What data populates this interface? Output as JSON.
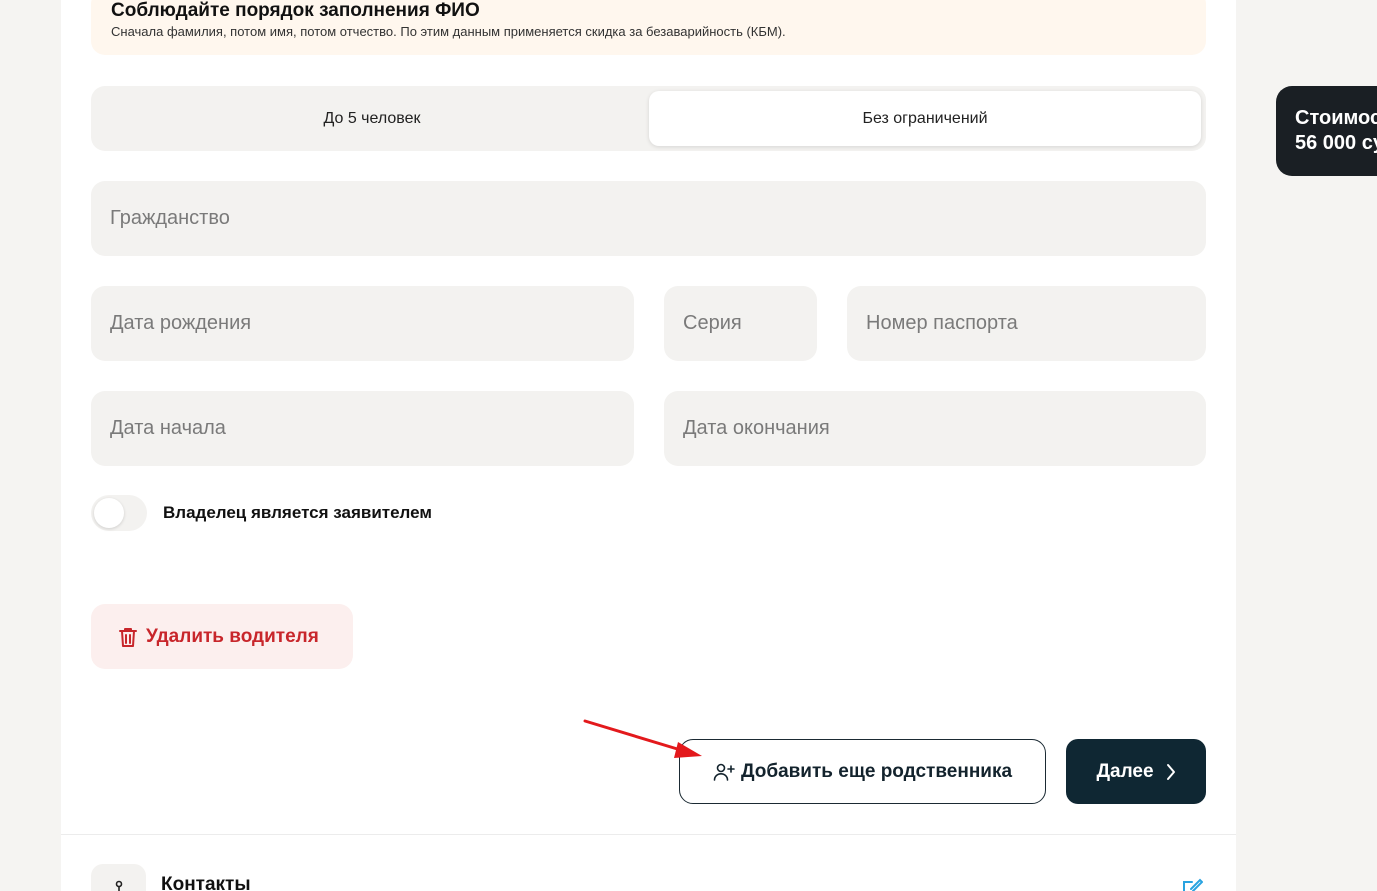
{
  "notice": {
    "title": "Соблюдайте порядок заполнения ФИО",
    "text": "Сначала фамилия, потом имя, потом отчество. По этим данным применяется скидка за безаварийность (КБМ)."
  },
  "driver_limit": {
    "options": [
      "До 5 человек",
      "Без ограничений"
    ],
    "selected": "Без ограничений"
  },
  "fields": {
    "citizenship": "Гражданство",
    "birth_date": "Дата рождения",
    "passport_series": "Серия",
    "passport_number": "Номер паспорта",
    "start_date": "Дата начала",
    "end_date": "Дата окончания"
  },
  "owner_toggle": {
    "label": "Владелец является заявителем",
    "on": false
  },
  "buttons": {
    "delete_driver": "Удалить водителя",
    "add_relative": "Добавить еще родственника",
    "next": "Далее"
  },
  "contacts": {
    "title": "Контакты"
  },
  "price": {
    "label": "Стоимос",
    "value": "56 000 су"
  },
  "colors": {
    "primary_dark": "#0f2733",
    "danger": "#c8262b",
    "danger_bg": "#fcefee",
    "notice_bg": "#fff7ee",
    "field_bg": "#f3f2f0",
    "annotation_arrow": "#e3191c"
  },
  "icons": {
    "delete": "trash-icon",
    "add_relative": "user-plus-icon",
    "next": "chevron-right-icon",
    "contacts": "location-pin-icon",
    "edit": "edit-icon"
  }
}
